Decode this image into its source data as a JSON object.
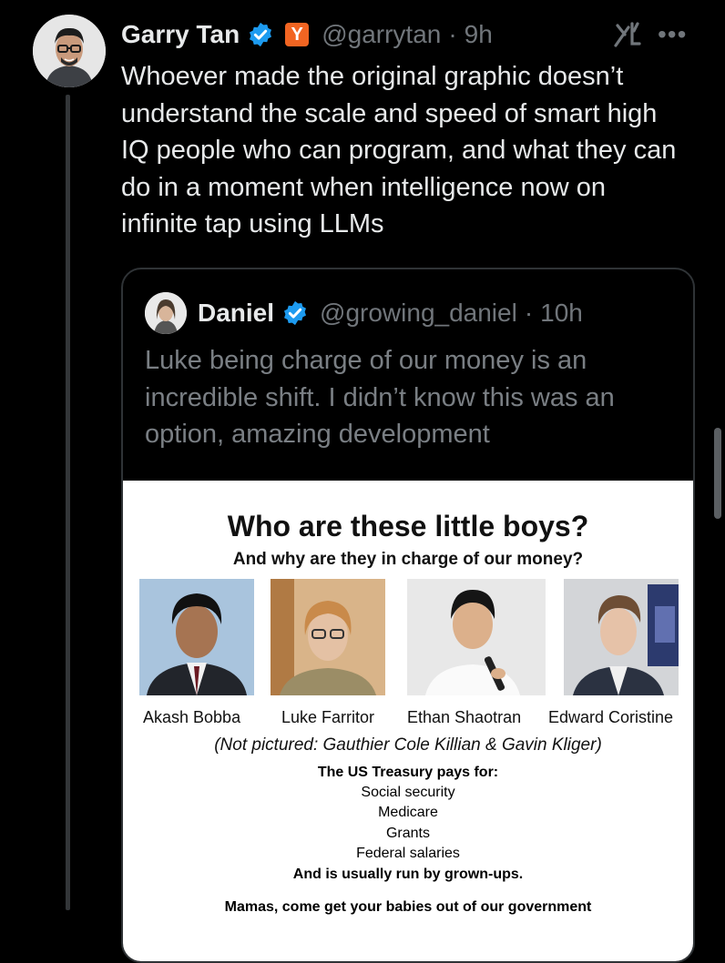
{
  "post": {
    "author_name": "Garry Tan",
    "author_handle": "@garrytan",
    "time": "9h",
    "badge_letter": "Y",
    "text": "Whoever made the original graphic doesn’t understand the scale and speed of smart high IQ people who can program, and what they can do in a moment when intelligence now on infinite tap using LLMs"
  },
  "quote": {
    "author_name": "Daniel",
    "author_handle": "@growing_daniel",
    "time": "10h",
    "text": "Luke being charge of our money is an incredible shift. I didn’t know this was an option, amazing development"
  },
  "graphic": {
    "title": "Who are these little boys?",
    "subtitle": "And why are they in charge of our money?",
    "people": [
      "Akash Bobba",
      "Luke Farritor",
      "Ethan Shaotran",
      "Edward Coristine"
    ],
    "not_pictured": "(Not pictured: Gauthier Cole Killian & Gavin Kliger)",
    "pays_title": "The US Treasury pays for:",
    "pays_items": [
      "Social security",
      "Medicare",
      "Grants",
      "Federal salaries"
    ],
    "pays_footer": "And is usually run by grown-ups.",
    "closing": "Mamas, come get your babies out of our government"
  },
  "icons": {
    "more": "more-icon",
    "grok": "grok-icon",
    "verified": "verified-icon"
  },
  "colors": {
    "background": "#000000",
    "verified_blue": "#1d9bf0",
    "yc_orange": "#f26522",
    "muted_text": "#71767b"
  }
}
